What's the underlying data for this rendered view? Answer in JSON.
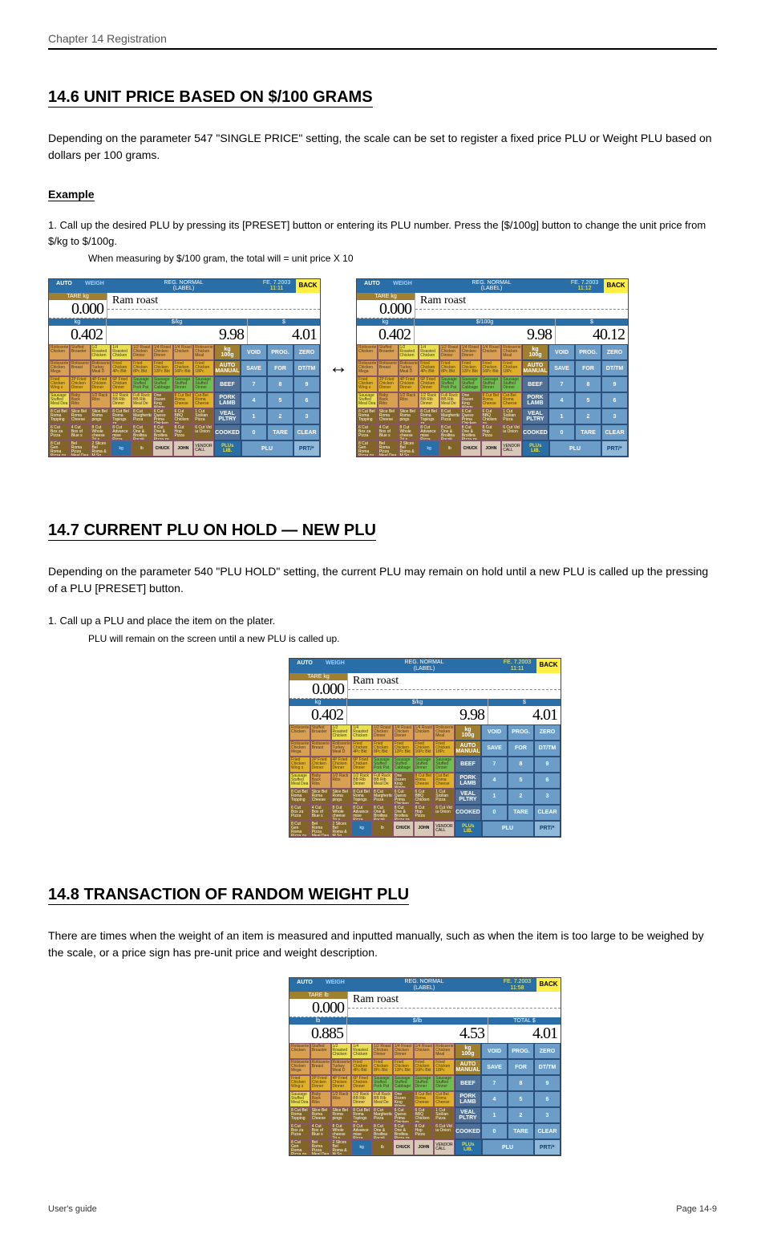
{
  "header": {
    "chapter": "Chapter 14  Registration"
  },
  "sections": {
    "unit_price_100g": {
      "title": "14.6  UNIT PRICE BASED ON $/100 GRAMS",
      "body": "Depending on the parameter 547 \"SINGLE PRICE\" setting, the scale can be set to register a fixed price PLU or Weight PLU based on dollars per 100 grams.",
      "example": "Example",
      "step1": "1.  Call up the desired PLU by pressing its [PRESET] button or entering its PLU number.  Press the [$/100g] button to change the unit price from $/kg to $/100g.",
      "step1_detail": "When measuring by $/100 gram, the total will = unit price X 10"
    },
    "plu_hold": {
      "title": "14.7  CURRENT PLU ON HOLD — NEW PLU",
      "body": "Depending on the parameter 540 \"PLU HOLD\" setting, the current PLU may remain on hold until a new PLU is called up the pressing of a PLU [PRESET] button.",
      "step1": "1.  Call up a PLU and place the item on the plater.",
      "step1_detail": "PLU will remain on the screen until a new PLU is called up."
    },
    "random_weight": {
      "title": "14.8  TRANSACTION OF RANDOM WEIGHT PLU",
      "body": "There are times when the weight of an item is measured and inputted manually, such as when the item is too large to be weighed by the scale, or a price sign has pre-unit price and weight description."
    }
  },
  "screen_common": {
    "tabs": {
      "auto": "AUTO",
      "weigh": "WEIGH"
    },
    "mode": "REG. NORMAL",
    "mode2": "(LABEL)",
    "back": "BACK",
    "tare_label_kg": "TARE  kg",
    "tare_label_lb": "TARE  lb",
    "tare_value": "0.000",
    "item_name": "Ram roast",
    "kg_label": "kg",
    "lb_label": "lb",
    "per_kg": "$/kg",
    "per_100g": "$/100g",
    "per_lb": "$/lb",
    "total_label": "$",
    "total_label_alt": "TOTAL $",
    "unit_kg": "kg",
    "unit_lb": "lb",
    "chuck": "CHUCK",
    "john": "JOHN",
    "vendor": "VENDOR CALL",
    "side": {
      "kg100g": [
        "kg",
        "100g"
      ],
      "automanual": [
        "AUTO",
        "MANUAL"
      ],
      "void": "VOID",
      "prog": "PROG.",
      "zero": "ZERO",
      "save": "SAVE",
      "for": "FOR",
      "dttm": "DT/TM",
      "beef": "BEEF",
      "7": "7",
      "8": "8",
      "9": "9",
      "porklamb": [
        "PORK",
        "LAMB"
      ],
      "4": "4",
      "5": "5",
      "6": "6",
      "vealpltry": [
        "VEAL",
        "PLTRY"
      ],
      "1": "1",
      "2": "2",
      "3": "3",
      "cooked": "COOKED",
      "0": "0",
      "tare": "TARE",
      "clear": "CLEAR",
      "pluslib": [
        "PLUs",
        "LIB."
      ],
      "plu": "PLU",
      "prt": "PRT/*"
    },
    "plu_labels": [
      "Rotisserie Chicken",
      "Stuffed Broaster",
      "1/2 Roasted Chicken",
      "1/4 Roasted Chicken",
      "1/2 Roast Chicken Dinner",
      "1/4 Roast Chicken Dinner",
      "1/4 Roast Chicken",
      "Rotisserie Chicken Meal",
      "Rotisserie Chicken Mega",
      "Rotisserie Breast",
      "Rotisserie Turkey Meal D",
      "Fried Chicken 4Pc Bkt",
      "Fried Chicken 8Pc Bkt",
      "Fried Chicken 12Pc Bkt",
      "Fried Chicken 16Pc Bkt",
      "Fried Chicken 18Pc",
      "Fried Chicken Wing s",
      "2P Fried Chicken Dinner",
      "4P Fried Chicken Dinner",
      "6P Fried Chicken Dinner",
      "Sausage Stuffed Pork Pat",
      "Sausage Stuffed Cabbage",
      "Sausage Stuffed Dinner",
      "Sausage Stuffed Dinner",
      "Sausage Stuffed Meal Dea",
      "Baby Back Ribs",
      "1/2 Rack Ribs",
      "1/2 Rack BB Rib Dinner",
      "Full Rack BB Rib Meal De",
      "One Dozen King Wings",
      "8 Cut Bel Roma Cheese",
      "Cut Bel Roma Cheese",
      "8 Cut Bel Roma Topping",
      "Slice Bel Roma Cheese",
      "Slice Bel Roma pings",
      "8 Cut Bel Roma Topings za",
      "8 Cut Margherita Pizza",
      "6 Cut Queso Prima Chicken",
      "6 Cut BBQ Chicken za",
      "1 Cut Sicilian Pizza",
      "6 Cut Box za Pizza",
      "4 Cut Box of Blue s",
      "8 Cut Whole cheese Tri s",
      "8 Cut Advance mise Pizza",
      "8 Cut One & Broiltea Pocoli",
      "8 Cut One & Broiltea Pizza za",
      "8 Cut Hop Pizza",
      "6 Cut Vid ia Onion",
      "8 Cut Gen Roma Pizza za",
      "Bel Roma Pizza Meal Dea ls",
      "2 Slices Bel Roma & M So"
    ]
  },
  "screens": {
    "s1": {
      "date": "FE. 7.2003",
      "time": "11:11",
      "kg": "0.402",
      "unit": "9.98",
      "total": "4.01",
      "unit_label": "$/kg",
      "wt_label": "kg",
      "total_hdr": "$",
      "tare_hdr": "TARE  kg"
    },
    "s2": {
      "date": "FE. 7.2003",
      "time": "11:12",
      "kg": "0.402",
      "unit": "9.98",
      "total": "40.12",
      "unit_label": "$/100g",
      "wt_label": "kg",
      "total_hdr": "$",
      "tare_hdr": "TARE  kg"
    },
    "s3": {
      "date": "FE. 7.2003",
      "time": "11:11",
      "kg": "0.402",
      "unit": "9.98",
      "total": "4.01",
      "unit_label": "$/kg",
      "wt_label": "kg",
      "total_hdr": "$",
      "tare_hdr": "TARE  kg"
    },
    "s4": {
      "date": "FE. 7.2003",
      "time": "11:58",
      "kg": "0.885",
      "unit": "4.53",
      "total": "4.01",
      "unit_label": "$/lb",
      "wt_label": "lb",
      "total_hdr": "TOTAL $",
      "tare_hdr": "TARE  lb"
    }
  },
  "footer": {
    "left": "User's guide",
    "right": "Page 14-9"
  }
}
